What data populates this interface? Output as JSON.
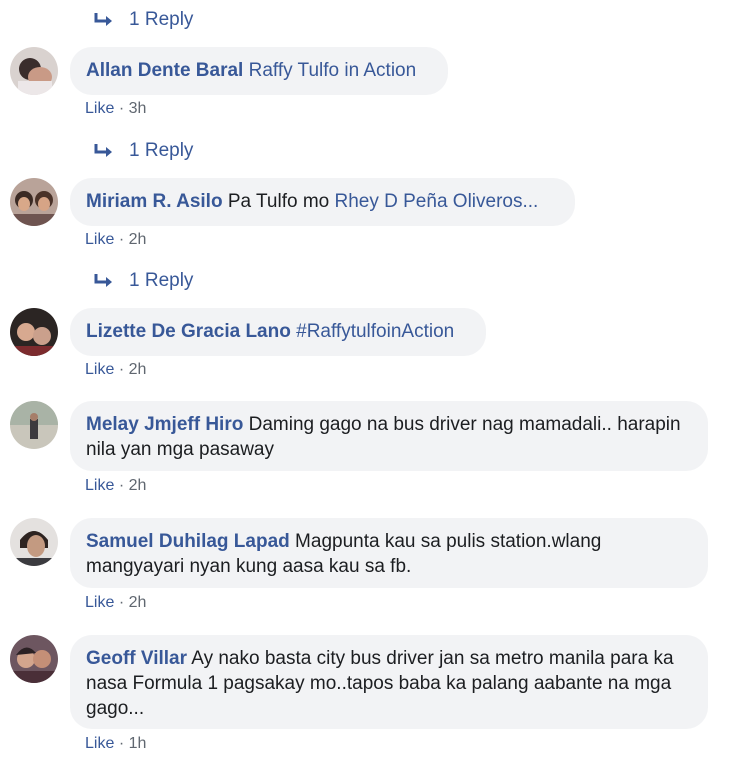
{
  "reply_label": "1 Reply",
  "like_label": "Like",
  "separator": "·",
  "comments": [
    {
      "author": "Allan Dente Baral",
      "text": "",
      "tag": "Raffy Tulfo in Action",
      "time": "3h"
    },
    {
      "author": "Miriam R. Asilo",
      "text": "Pa Tulfo mo",
      "tag": "Rhey D Peña Oliveros...",
      "time": "2h"
    },
    {
      "author": "Lizette De Gracia Lano",
      "text": "",
      "tag": "#RaffytulfoinAction",
      "time": "2h"
    },
    {
      "author": "Melay Jmjeff Hiro",
      "text": "Daming gago na bus driver nag mamadali.. harapin nila yan mga pasaway",
      "tag": "",
      "time": "2h"
    },
    {
      "author": "Samuel Duhilag Lapad",
      "text": "Magpunta kau sa pulis station.wlang mangyayari nyan kung aasa kau sa fb.",
      "tag": "",
      "time": "2h"
    },
    {
      "author": "Geoff Villar",
      "text": "Ay nako basta city bus driver jan sa metro manila para ka nasa Formula 1 pagsakay mo..tapos baba ka palang aabante na mga gago...",
      "tag": "",
      "time": "1h"
    }
  ]
}
